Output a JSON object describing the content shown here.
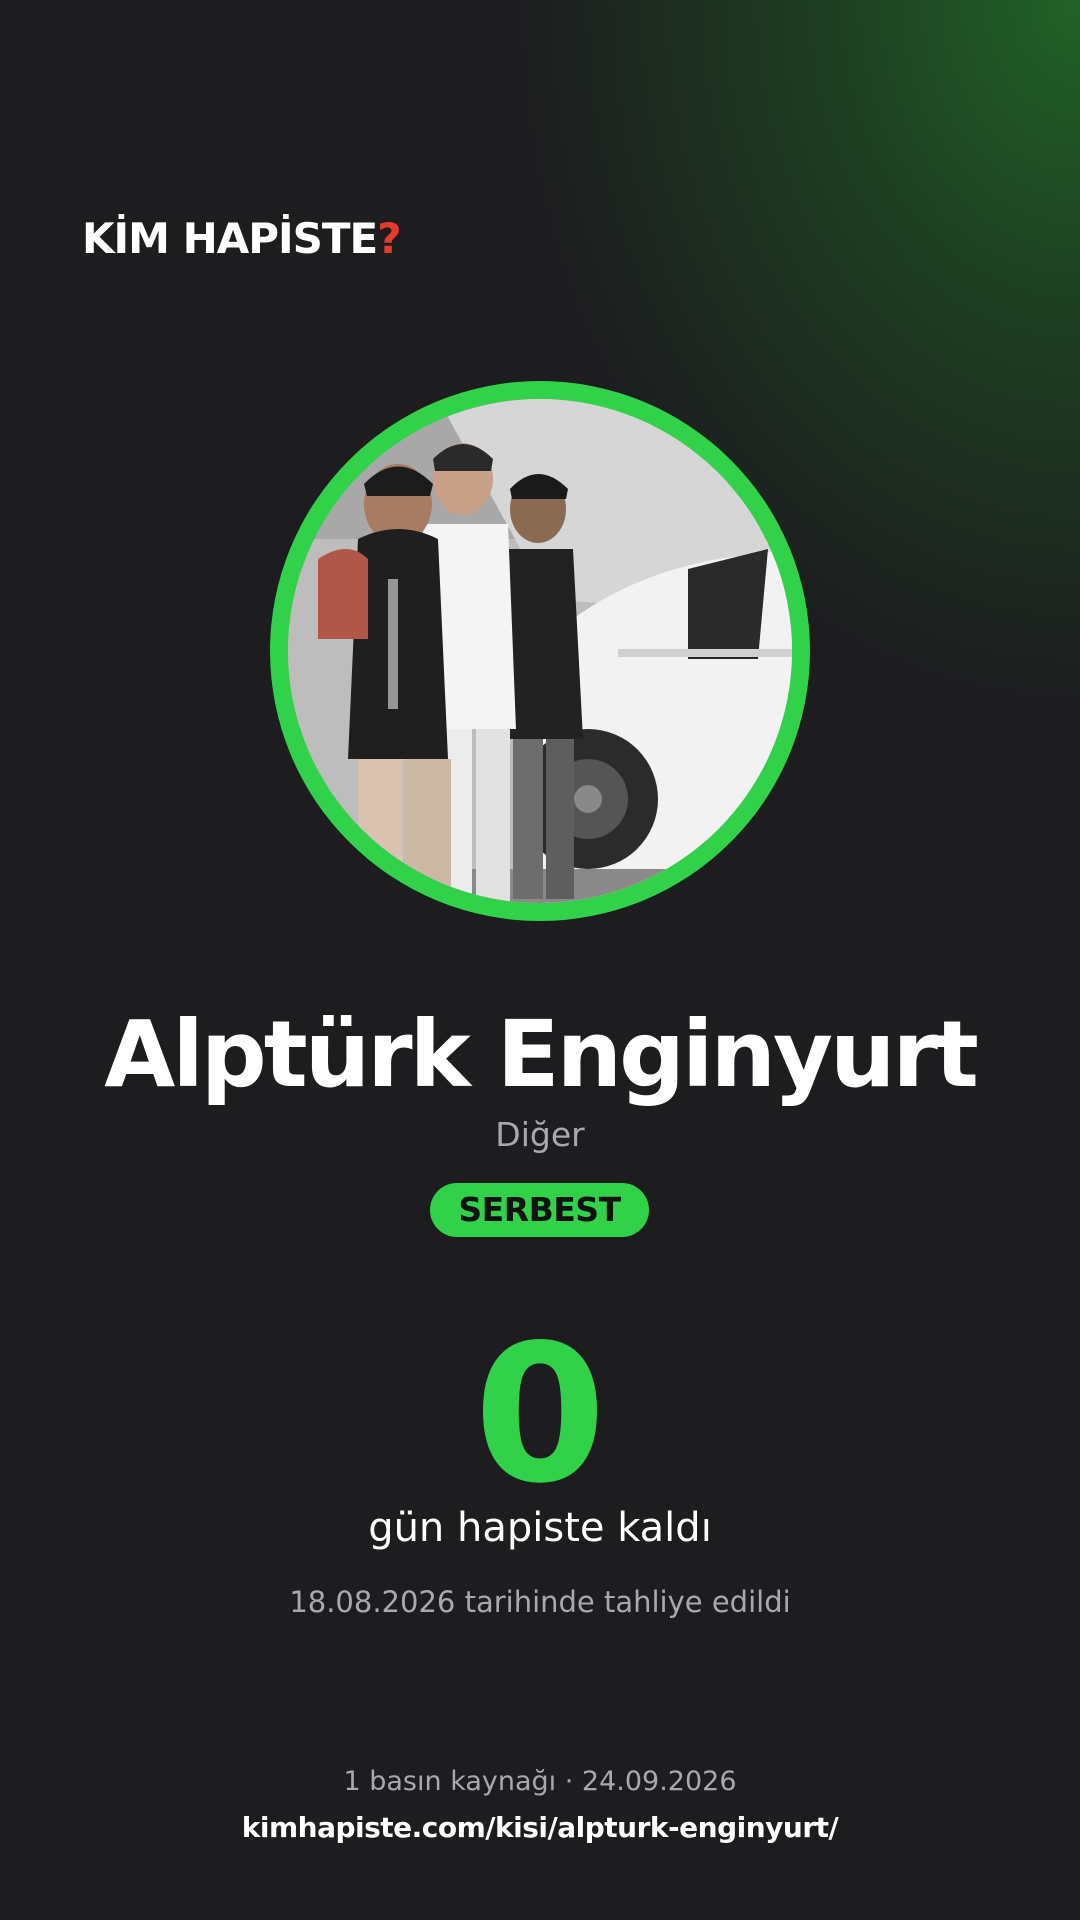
{
  "brand": {
    "logo_text": "KİM HAPİSTE",
    "logo_mark": "?",
    "accent_color": "#31d14a",
    "mark_color": "#e8392e"
  },
  "person": {
    "name": "Alptürk Enginyurt",
    "category": "Diğer",
    "status": "SERBEST",
    "photo_icon": "person-photo"
  },
  "stats": {
    "days": "0",
    "days_label": "gün hapiste kaldı",
    "release_text": "18.08.2026 tarihinde tahliye edildi"
  },
  "footer": {
    "sources_text": "1 basın kaynağı · 24.09.2026",
    "url": "kimhapiste.com/kisi/alpturk-enginyurt/"
  }
}
